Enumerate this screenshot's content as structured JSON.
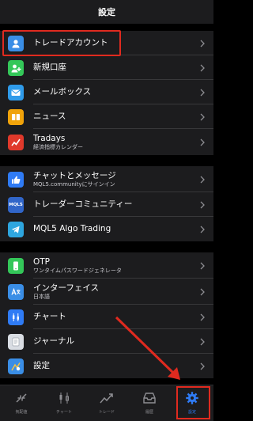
{
  "header": {
    "title": "設定"
  },
  "groups": [
    {
      "items": [
        {
          "label": "トレードアカウント",
          "icon": "person-icon",
          "color": "#3a8ee6"
        },
        {
          "label": "新規口座",
          "icon": "add-person-icon",
          "color": "#34c759"
        },
        {
          "label": "メールボックス",
          "icon": "mail-icon",
          "color": "#2f9bea"
        },
        {
          "label": "ニュース",
          "icon": "news-icon",
          "color": "#f0a30a"
        },
        {
          "label": "Tradays",
          "sub": "経済指標カレンダー",
          "icon": "tradays-icon",
          "color": "#e0392b"
        }
      ]
    },
    {
      "items": [
        {
          "label": "チャットとメッセージ",
          "sub": "MQL5.communityにサインイン",
          "icon": "thumbs-up-icon",
          "color": "#2f7bf5"
        },
        {
          "label": "トレーダーコミュニティー",
          "icon": "mql5-icon",
          "color": "#3166c9",
          "icon_text": "MQL5"
        },
        {
          "label": "MQL5 Algo Trading",
          "icon": "telegram-icon",
          "color": "#2ea6df"
        }
      ]
    },
    {
      "items": [
        {
          "label": "OTP",
          "sub": "ワンタイムパスワードジェネレータ",
          "icon": "otp-icon",
          "color": "#34c759"
        },
        {
          "label": "インターフェイス",
          "sub": "日本語",
          "icon": "translate-icon",
          "color": "#3a8ee6"
        },
        {
          "label": "チャート",
          "icon": "chart-settings-icon",
          "color": "#2f7bf5"
        },
        {
          "label": "ジャーナル",
          "icon": "journal-icon",
          "color": "#d9dde3"
        },
        {
          "label": "設定",
          "icon": "settings-app-icon",
          "color": "#3a8ee6"
        }
      ]
    }
  ],
  "tabbar": {
    "tabs": [
      {
        "label": "気配値",
        "icon": "quotes-icon"
      },
      {
        "label": "チャート",
        "icon": "chart-tab-icon"
      },
      {
        "label": "トレード",
        "icon": "trade-tab-icon"
      },
      {
        "label": "履歴",
        "icon": "history-tab-icon"
      },
      {
        "label": "設定",
        "icon": "gear-tab-icon",
        "active": true
      }
    ]
  },
  "colors": {
    "highlight": "#e02a1f",
    "accent": "#2f7bf5",
    "background": "#000000",
    "panel": "#1c1c1e"
  }
}
